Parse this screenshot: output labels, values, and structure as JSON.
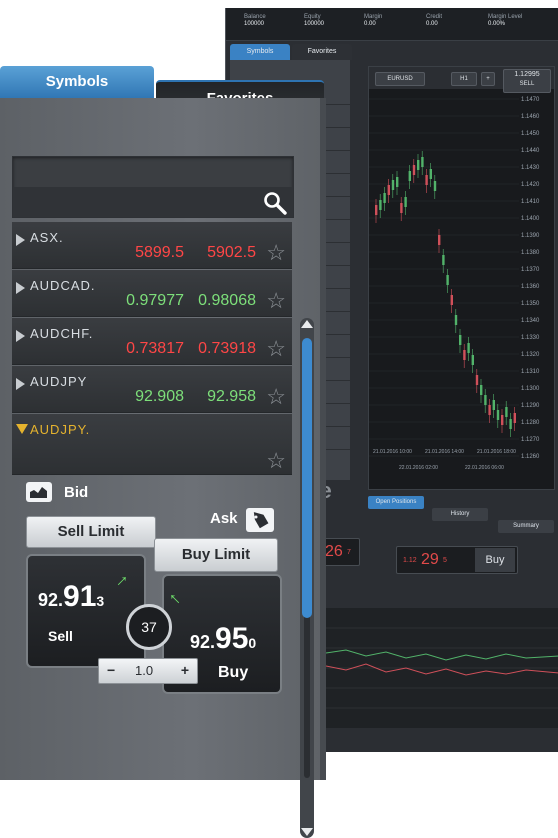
{
  "back": {
    "top_info": [
      {
        "label": "Balance",
        "value": "100000"
      },
      {
        "label": "Equity",
        "value": "100000"
      },
      {
        "label": "Margin",
        "value": "0.00"
      },
      {
        "label": "Credit",
        "value": "0.00"
      },
      {
        "label": "Margin Level",
        "value": "0.00%"
      }
    ],
    "tabs": [
      "Symbols",
      "Favorites"
    ],
    "chart": {
      "symbol": "EURUSD",
      "timeframe": "H1",
      "sell_label": "SELL",
      "sell_price": "1.12995",
      "y_ticks": [
        "1.1470",
        "1.1460",
        "1.1450",
        "1.1440",
        "1.1430",
        "1.1420",
        "1.1410",
        "1.1400",
        "1.1390",
        "1.1380",
        "1.1370",
        "1.1360",
        "1.1350",
        "1.1340",
        "1.1330",
        "1.1320",
        "1.1310",
        "1.1300",
        "1.1290",
        "1.1280",
        "1.1270",
        "1.1260"
      ],
      "x_ticks": [
        "21.01.2016 10:00",
        "21.01.2016 14:00",
        "21.01.2016 18:00"
      ],
      "bottom_ticks": [
        "22.01.2016 02:00",
        "22.01.2016 06:00"
      ]
    },
    "bottom_tabs": [
      "Open Positions",
      "History",
      "Summary"
    ],
    "price1": "26",
    "price1_sup": "7",
    "price2_prefix": "1.12",
    "price2": "29",
    "price2_sup": "5",
    "buy_label": "Buy",
    "partial_word": "de"
  },
  "front": {
    "tab_symbols": "Symbols",
    "tab_favorites": "Favorites",
    "rows": [
      {
        "symbol": "ASX.",
        "bid": "5899.5",
        "ask": "5902.5",
        "color": "#ff4646"
      },
      {
        "symbol": "AUDCAD.",
        "bid": "0.97977",
        "ask": "0.98068",
        "color": "#7ddf7a"
      },
      {
        "symbol": "AUDCHF.",
        "bid": "0.73817",
        "ask": "0.73918",
        "color": "#ff4646"
      },
      {
        "symbol": "AUDJPY",
        "bid": "92.908",
        "ask": "92.958",
        "color": "#7ddf7a"
      }
    ],
    "expanded_symbol": "AUDJPY.",
    "bid_label": "Bid",
    "ask_label": "Ask",
    "sell_limit": "Sell Limit",
    "buy_limit": "Buy Limit",
    "sell_price": {
      "prefix": "92.",
      "big": "91",
      "sub": "3"
    },
    "buy_price": {
      "prefix": "92.",
      "big": "95",
      "sub": "0"
    },
    "spread": "37",
    "sell": "Sell",
    "buy": "Buy",
    "qty": "1.0",
    "minus": "−",
    "plus": "+"
  }
}
